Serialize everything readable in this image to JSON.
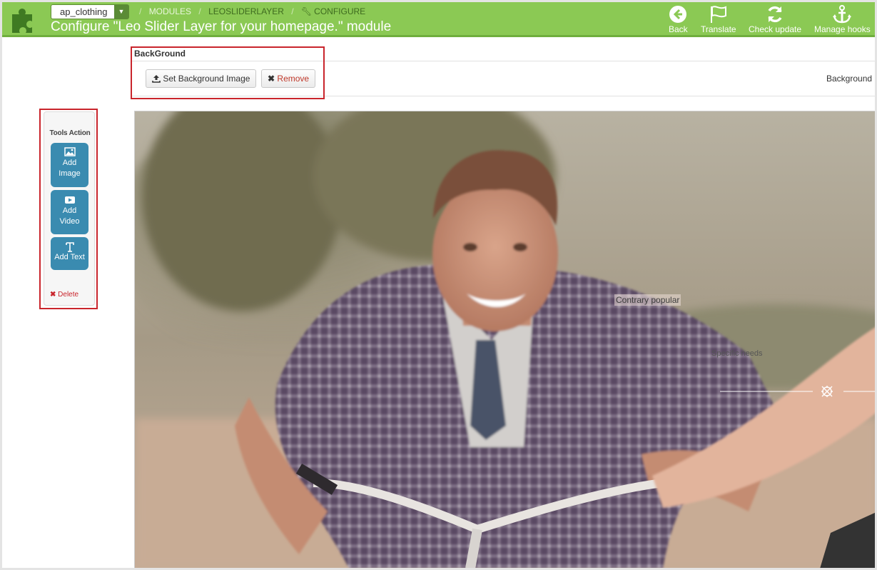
{
  "header": {
    "shop_select": "ap_clothing",
    "breadcrumb": {
      "modules": "MODULES",
      "module": "LEOSLIDERLAYER",
      "configure": "CONFIGURE"
    },
    "title": "Configure \"Leo Slider Layer for your homepage.\" module",
    "toolbar": {
      "back": "Back",
      "translate": "Translate",
      "check_update": "Check update",
      "manage_hooks": "Manage hooks"
    }
  },
  "background": {
    "label": "BackGround",
    "set_button": "Set Background Image",
    "remove_button": "Remove",
    "right_label": "Background"
  },
  "tools": {
    "title": "Tools Action",
    "add_image": "Add Image",
    "add_video": "Add Video",
    "add_text": "Add Text",
    "delete": "Delete"
  },
  "canvas": {
    "layer_texts": [
      "Contrary popular",
      "Specific needs"
    ]
  },
  "colors": {
    "header_bg": "#8bc954",
    "tool_button": "#3a8bb0",
    "highlight_box": "#c9252c"
  }
}
